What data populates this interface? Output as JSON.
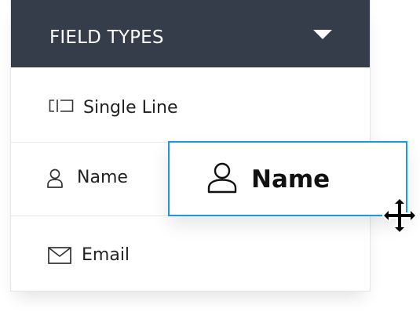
{
  "panel": {
    "title": "FIELD TYPES",
    "toggle_icon": "caret-down-icon",
    "header_color": "#363d4a",
    "items": [
      {
        "label": "Single Line",
        "icon": "single-line-field-icon"
      },
      {
        "label": "Name",
        "icon": "person-icon"
      },
      {
        "label": "Email",
        "icon": "envelope-icon"
      }
    ]
  },
  "drag_preview": {
    "label": "Name",
    "icon": "person-icon",
    "border_color": "#1a9ad6"
  },
  "cursor": {
    "icon": "move-cursor-icon"
  }
}
